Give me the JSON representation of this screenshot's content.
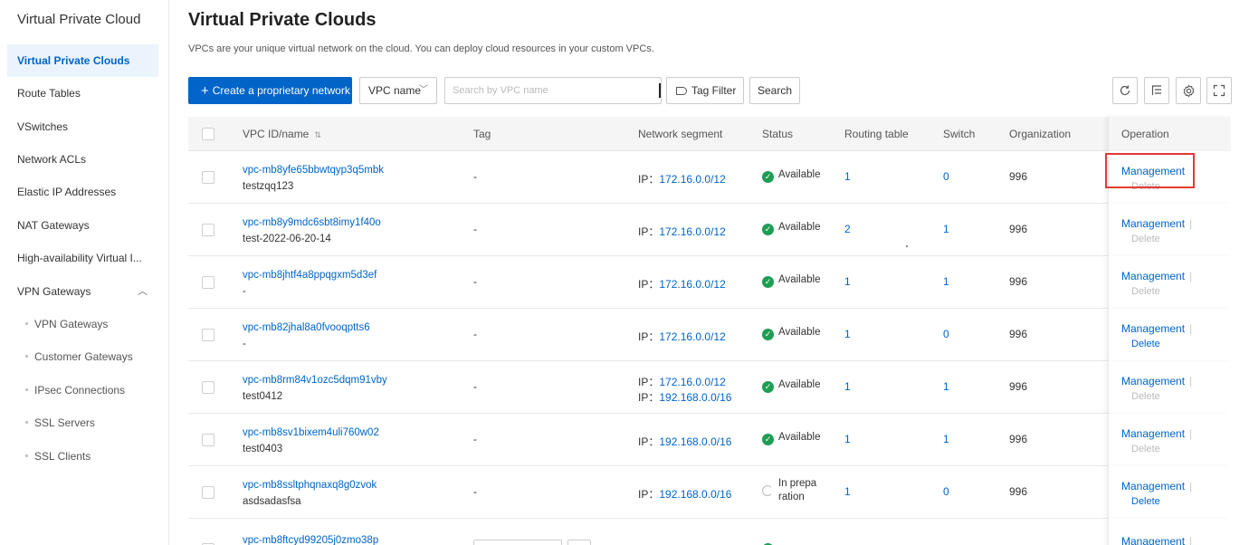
{
  "sidebar": {
    "title": "Virtual Private Cloud",
    "items": [
      {
        "label": "Virtual Private Clouds",
        "active": true
      },
      {
        "label": "Route Tables"
      },
      {
        "label": "VSwitches"
      },
      {
        "label": "Network ACLs"
      },
      {
        "label": "Elastic IP Addresses"
      },
      {
        "label": "NAT Gateways"
      },
      {
        "label": "High-availability Virtual I..."
      },
      {
        "label": "VPN Gateways",
        "expanded": true
      }
    ],
    "sub_items": [
      {
        "label": "VPN Gateways"
      },
      {
        "label": "Customer Gateways"
      },
      {
        "label": "IPsec Connections"
      },
      {
        "label": "SSL Servers"
      },
      {
        "label": "SSL Clients"
      }
    ]
  },
  "header": {
    "title": "Virtual Private Clouds",
    "description": "VPCs are your unique virtual network on the cloud. You can deploy cloud resources in your custom VPCs."
  },
  "toolbar": {
    "create_label": "Create a proprietary network",
    "filter_select": "VPC name",
    "search_placeholder": "Search by VPC name",
    "tag_filter_label": "Tag Filter",
    "search_label": "Search"
  },
  "table": {
    "columns": {
      "id": "VPC ID/name",
      "tag": "Tag",
      "segment": "Network segment",
      "status": "Status",
      "routing": "Routing table",
      "switch": "Switch",
      "org": "Organization",
      "operation": "Operation"
    },
    "ip_prefix": "IP：",
    "manage_label": "Management",
    "delete_label": "Delete",
    "separator": "|",
    "rows": [
      {
        "id": "vpc-mb8yfe65bbwtqyp3q5mbk",
        "name": "testzqq123",
        "tag": "-",
        "segments": [
          "172.16.0.0/12"
        ],
        "status": "Available",
        "routing": "1",
        "switch": "0",
        "org": "996",
        "delete_enabled": false
      },
      {
        "id": "vpc-mb8y9mdc6sbt8imy1f40o",
        "name": "test-2022-06-20-14",
        "tag": "-",
        "segments": [
          "172.16.0.0/12"
        ],
        "status": "Available",
        "routing": "2",
        "switch": "1",
        "org": "996",
        "delete_enabled": false
      },
      {
        "id": "vpc-mb8jhtf4a8ppqgxm5d3ef",
        "name": "-",
        "tag": "-",
        "segments": [
          "172.16.0.0/12"
        ],
        "status": "Available",
        "routing": "1",
        "switch": "1",
        "org": "996",
        "delete_enabled": false
      },
      {
        "id": "vpc-mb82jhal8a0fvooqptts6",
        "name": "-",
        "tag": "-",
        "segments": [
          "172.16.0.0/12"
        ],
        "status": "Available",
        "routing": "1",
        "switch": "0",
        "org": "996",
        "delete_enabled": true
      },
      {
        "id": "vpc-mb8rm84v1ozc5dqm91vby",
        "name": "test0412",
        "tag": "-",
        "segments": [
          "172.16.0.0/12",
          "192.168.0.0/16"
        ],
        "status": "Available",
        "routing": "1",
        "switch": "1",
        "org": "996",
        "delete_enabled": false
      },
      {
        "id": "vpc-mb8sv1bixem4uli760w02",
        "name": "test0403",
        "tag": "-",
        "segments": [
          "192.168.0.0/16"
        ],
        "status": "Available",
        "routing": "1",
        "switch": "1",
        "org": "996",
        "delete_enabled": false
      },
      {
        "id": "vpc-mb8ssltphqnaxq8g0zvok",
        "name": "asdsadasfsa",
        "tag": "-",
        "segments": [
          "192.168.0.0/16"
        ],
        "status_line1": "In prepa",
        "status_line2": "ration",
        "routing": "1",
        "switch": "0",
        "org": "996",
        "delete_enabled": true
      },
      {
        "id": "vpc-mb8ftcyd99205j0zmo38p",
        "manage_only": true
      }
    ]
  },
  "colors": {
    "primary": "#0064c8",
    "success": "#1f9d55",
    "highlight": "#e53935"
  }
}
